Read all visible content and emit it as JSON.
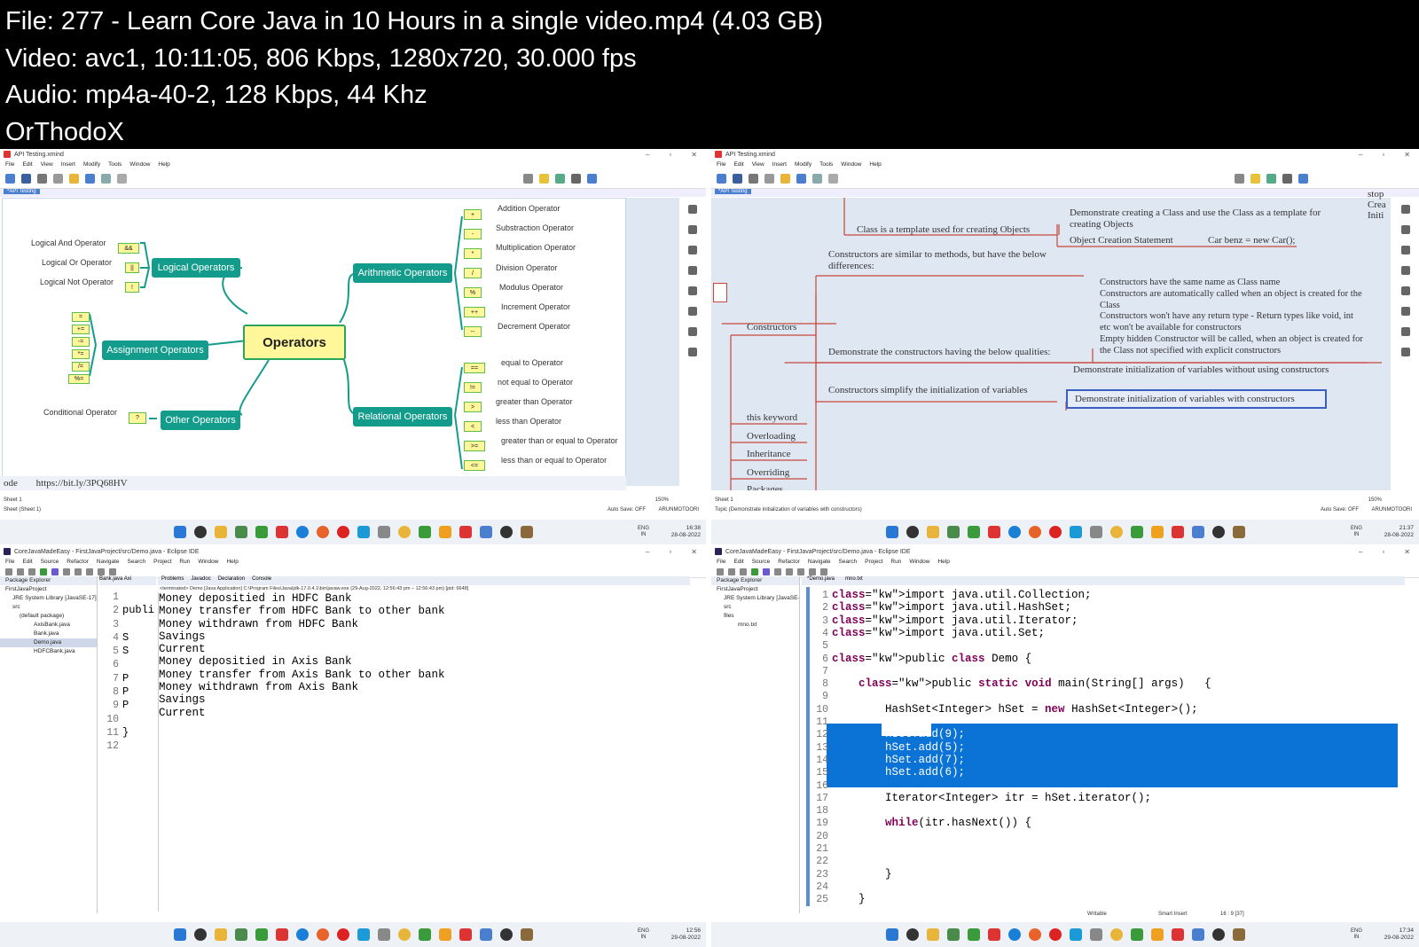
{
  "header": {
    "line1": "File: 277 - Learn Core Java in 10 Hours in a single video.mp4 (4.03 GB)",
    "line2": "Video: avc1, 10:11:05, 806 Kbps, 1280x720, 30.000 fps",
    "line3": "Audio: mp4a-40-2, 128 Kbps, 44 Khz",
    "line4": "OrThodoX"
  },
  "xmind": {
    "window_title": "API Testing.xmind",
    "menu": [
      "File",
      "Edit",
      "View",
      "Insert",
      "Modify",
      "Tools",
      "Window",
      "Help"
    ],
    "tab": "*API Testing",
    "sheet": "Sheet 1",
    "zoom": "150%",
    "auto_save": "Auto Save: OFF",
    "user": "ARUNMOTOORI"
  },
  "mm1": {
    "center": "Operators",
    "logical": "Logical Operators",
    "assignment": "Assignment Operators",
    "other": "Other Operators",
    "arithmetic": "Arithmetic Operators",
    "relational": "Relational Operators",
    "logical_items": [
      {
        "label": "Logical And Operator",
        "sym": "&&"
      },
      {
        "label": "Logical Or Operator",
        "sym": "||"
      },
      {
        "label": "Logical Not Operator",
        "sym": "!"
      }
    ],
    "assign_syms": [
      "=",
      "+=",
      "-=",
      "*=",
      "/=",
      "%="
    ],
    "other_items": [
      {
        "label": "Conditional Operator",
        "sym": "?"
      }
    ],
    "arith_items": [
      {
        "sym": "+",
        "label": "Addition Operator"
      },
      {
        "sym": "-",
        "label": "Substraction Operator"
      },
      {
        "sym": "*",
        "label": "Multiplication Operator"
      },
      {
        "sym": "/",
        "label": "Division Operator"
      },
      {
        "sym": "%",
        "label": "Modulus Operator"
      },
      {
        "sym": "++",
        "label": "Increment Operator"
      },
      {
        "sym": "--",
        "label": "Decrement Operator"
      }
    ],
    "rel_items": [
      {
        "sym": "==",
        "label": "equal to Operator"
      },
      {
        "sym": "!=",
        "label": "not equal to Operator"
      },
      {
        "sym": ">",
        "label": "greater than Operator"
      },
      {
        "sym": "<",
        "label": "less than Operator"
      },
      {
        "sym": ">=",
        "label": "greater than or equal to Operator"
      },
      {
        "sym": "<=",
        "label": "less than or equal to Operator"
      }
    ],
    "bottom_left": "ode",
    "url": "https://bit.ly/3PQ68HV",
    "status": "Sheet (Sheet 1)",
    "time": "16:38",
    "date": "28-08-2022"
  },
  "mm2": {
    "class_node": "Class is a template used for creating Objects",
    "demo_class": "Demonstrate creating a Class and use the Class as a template for creating Objects",
    "obj_stmt": "Object Creation Statement",
    "car_benz": "Car benz = new Car();",
    "constructors_similar": "Constructors are similar to methods, but have the below differences:",
    "constructors": "Constructors",
    "qualities": "Demonstrate the constructors having the below qualities:",
    "qual_lines": [
      "Constructors have the same name as Class name",
      "Constructors are automatically called when an object is created for the Class",
      "Constructors won't have any return type - Return types like void, int etc won't be available for constructors",
      "Empty hidden Constructor will be called, when an object is created for the Class not specified with explicit constructors"
    ],
    "simplify": "Constructors simplify the initialization of variables",
    "init_without": "Demonstrate initialization of variables without using constructors",
    "init_with": "Demonstrate initialization of variables with constructors",
    "siblings": [
      "this keyword",
      "Overloading",
      "Inheritance",
      "Overriding",
      "Packages"
    ],
    "top_right": [
      "stop",
      "Crea",
      "Initi"
    ],
    "status": "Topic (Demonstrate initialization of variables with constructors)",
    "time": "21:37",
    "date": "28-08-2022"
  },
  "eclipse": {
    "title1": "CoreJavaMadeEasy - FirstJavaProject/src/Demo.java - Eclipse IDE",
    "menu": [
      "File",
      "Edit",
      "Source",
      "Refactor",
      "Navigate",
      "Search",
      "Project",
      "Run",
      "Window",
      "Help"
    ],
    "pkg_explorer": "Package Explorer",
    "project": "FirstJavaProject",
    "jre": "JRE System Library [JavaSE-17]",
    "src": "src",
    "default_pkg": "(default package)",
    "files": [
      "AxisBank.java",
      "Bank.java",
      "Demo.java",
      "HDFCBank.java"
    ],
    "editor_tabs": [
      "Bank.java",
      "Axi"
    ],
    "console_tabs": [
      "Problems",
      "Javadoc",
      "Declaration",
      "Console"
    ],
    "terminated": "<terminated> Demo [Java Application] C:\\Program Files\\Java\\jdk-17.0.4.1\\bin\\javaw.exe (29-Aug-2022, 12:56:43 pm – 12:56:43 pm) [pid: 6648]",
    "console": [
      "Money depositied in HDFC Bank",
      "Money transfer from HDFC Bank to other bank",
      "Money withdrawn from HDFC Bank",
      "Savings",
      "Current",
      "Money depositied in Axis Bank",
      "Money transfer from Axis Bank to other bank",
      "Money withdrawn from Axis Bank",
      "Savings",
      "Current"
    ],
    "gutter_nums": [
      "1",
      "2",
      "3",
      "4",
      "5",
      "6",
      "7",
      "8",
      "9",
      "10",
      "11",
      "12"
    ],
    "gutter_frags": [
      "",
      "publi",
      "",
      "S",
      "S",
      "",
      "P",
      "P",
      "P",
      "",
      "}",
      ""
    ],
    "time": "12:56",
    "date": "29-08-2022"
  },
  "eclipse2": {
    "files_folder": "files",
    "mno": "mno.txt",
    "tabs": [
      "*Demo.java",
      "mno.txt"
    ],
    "lines": [
      {
        "n": "1",
        "code": "import java.util.Collection;"
      },
      {
        "n": "2",
        "code": "import java.util.HashSet;"
      },
      {
        "n": "3",
        "code": "import java.util.Iterator;"
      },
      {
        "n": "4",
        "code": "import java.util.Set;"
      },
      {
        "n": "5",
        "code": ""
      },
      {
        "n": "6",
        "code": "public class Demo {"
      },
      {
        "n": "7",
        "code": ""
      },
      {
        "n": "8",
        "code": "    public static void main(String[] args)   {"
      },
      {
        "n": "9",
        "code": ""
      },
      {
        "n": "10",
        "code": "        HashSet<Integer> hSet = new HashSet<Integer>();"
      },
      {
        "n": "11",
        "code": ""
      },
      {
        "n": "12",
        "code": "        hSet.add(9);"
      },
      {
        "n": "13",
        "code": "        hSet.add(5);"
      },
      {
        "n": "14",
        "code": "        hSet.add(7);"
      },
      {
        "n": "15",
        "code": "        hSet.add(6);"
      },
      {
        "n": "16",
        "code": ""
      },
      {
        "n": "17",
        "code": "        Iterator<Integer> itr = hSet.iterator();"
      },
      {
        "n": "18",
        "code": ""
      },
      {
        "n": "19",
        "code": "        while(itr.hasNext()) {"
      },
      {
        "n": "20",
        "code": ""
      },
      {
        "n": "21",
        "code": ""
      },
      {
        "n": "22",
        "code": ""
      },
      {
        "n": "23",
        "code": "        }"
      },
      {
        "n": "24",
        "code": ""
      },
      {
        "n": "25",
        "code": "    }"
      }
    ],
    "status_writable": "Writable",
    "status_insert": "Smart Insert",
    "status_pos": "16 : 9 [37]",
    "time": "17:34",
    "date": "29-08-2022"
  },
  "lang": {
    "l1": "ENG",
    "l2": "IN"
  }
}
